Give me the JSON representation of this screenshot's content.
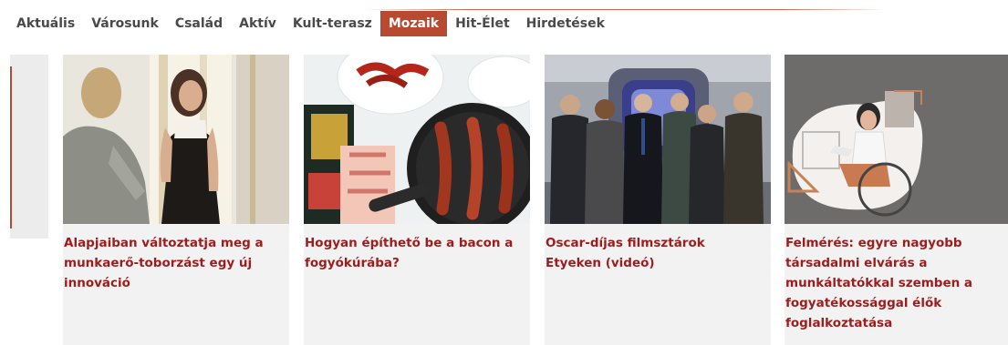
{
  "nav": {
    "items": [
      "Aktuális",
      "Városunk",
      "Család",
      "Aktív",
      "Kult-terasz",
      "Mozaik",
      "Hit-Élet",
      "Hirdetések"
    ],
    "active": "Mozaik"
  },
  "cards": [
    {
      "title": "Alapjaiban változtatja meg a munkaerő-toborzást egy új innováció",
      "image": "office-meeting-photo"
    },
    {
      "title": "Hogyan építhető be a bacon a fogyókúrába?",
      "image": "bacon-pan-photo"
    },
    {
      "title": "Oscar-díjas filmsztárok Etyeken (videó)",
      "image": "group-of-men-photo"
    },
    {
      "title": "Felmérés: egyre nagyobb társadalmi elvárás a munkáltatókkal szemben a fogyatékossággal élők foglalkoztatása",
      "image": "wheelchair-illustration"
    }
  ],
  "colors": {
    "accent": "#b84a31",
    "title_red": "#9c1d1d",
    "nav_text": "#4a4a4a",
    "card_bg": "#f2f2f2"
  }
}
